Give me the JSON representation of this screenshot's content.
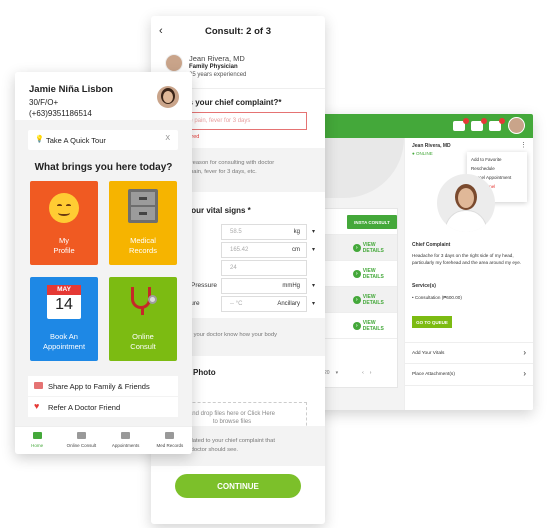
{
  "desktop": {
    "doctor_name": "Jean Rivera, MD",
    "status": "ONLINE",
    "menu": [
      "Add to Favorite",
      "Reschedule",
      "Cancel Appointment",
      "Close Panel"
    ],
    "chief_complaint_label": "Chief Complaint",
    "chief_complaint_text": "Headache for 3 days on the right side of my head, particularly my forehead and the area around my eye.",
    "services_label": "Service(s)",
    "service_item": "• Consultation (₱600.00)",
    "queue_button": "GO TO QUEUE",
    "add_vitals": "Add Your Vitals",
    "place_attachments": "Place Attachment(s)",
    "insta_consult": "INSTA CONSULT",
    "view_details": "VIEW DETAILS",
    "pager_size": "20",
    "colors": {
      "accent": "#44a83a"
    }
  },
  "consult": {
    "title": "Consult: 2 of 3",
    "doctor_name": "Jean Rivera, MD",
    "specialty": "Family Physician",
    "experience": "25 years experienced",
    "complaint_q": "at is your chief complaint?*",
    "complaint_placeholder": "scle pain, fever for 3 days",
    "required": "equired",
    "complaint_hint_1": "the reason for consulting with doctor",
    "complaint_hint_2": "cle pain, fever for 3 days, etc.",
    "vitals_q": "ut your vital signs *",
    "vitals": [
      {
        "label": "nt",
        "value": "58.5",
        "unit": "kg"
      },
      {
        "label": "t",
        "value": "165.42",
        "unit": "cm"
      },
      {
        "label": "",
        "value": "24",
        "unit": ""
      },
      {
        "label": "Pressure",
        "value": "",
        "unit": "mmHg"
      },
      {
        "label": "erature",
        "value": "-- °C",
        "unit": "Ancillary"
      }
    ],
    "vitals_hint": "help your doctor know how your body",
    "attach_title": "ach Photo",
    "drop_1": "and drop files here or Click Here",
    "drop_2": "to browse files",
    "attach_hint_1": "tos related to your chief complaint that",
    "attach_hint_2": "the doctor should see.",
    "continue": "CONTINUE"
  },
  "home": {
    "name": "Jamie Niña Lisbon",
    "age_sex_blood": "30/F/O+",
    "phone": "(+63)9351186514",
    "tour": "Take A Quick Tour",
    "tour_close": "X",
    "question": "What brings you here today?",
    "tiles": [
      {
        "label_1": "My",
        "label_2": "Profile",
        "color": "#f05a22"
      },
      {
        "label_1": "Medical",
        "label_2": "Records",
        "color": "#f6b400"
      },
      {
        "label_1": "Book An",
        "label_2": "Appointment",
        "color": "#1e88e5"
      },
      {
        "label_1": "Online",
        "label_2": "Consult",
        "color": "#7cbb12"
      }
    ],
    "calendar_month": "MAY",
    "calendar_day": "14",
    "share": "Share App to Family & Friends",
    "refer": "Refer A Doctor Friend",
    "nav": [
      "Home",
      "Online Consult",
      "Appointments",
      "Med Records"
    ]
  }
}
